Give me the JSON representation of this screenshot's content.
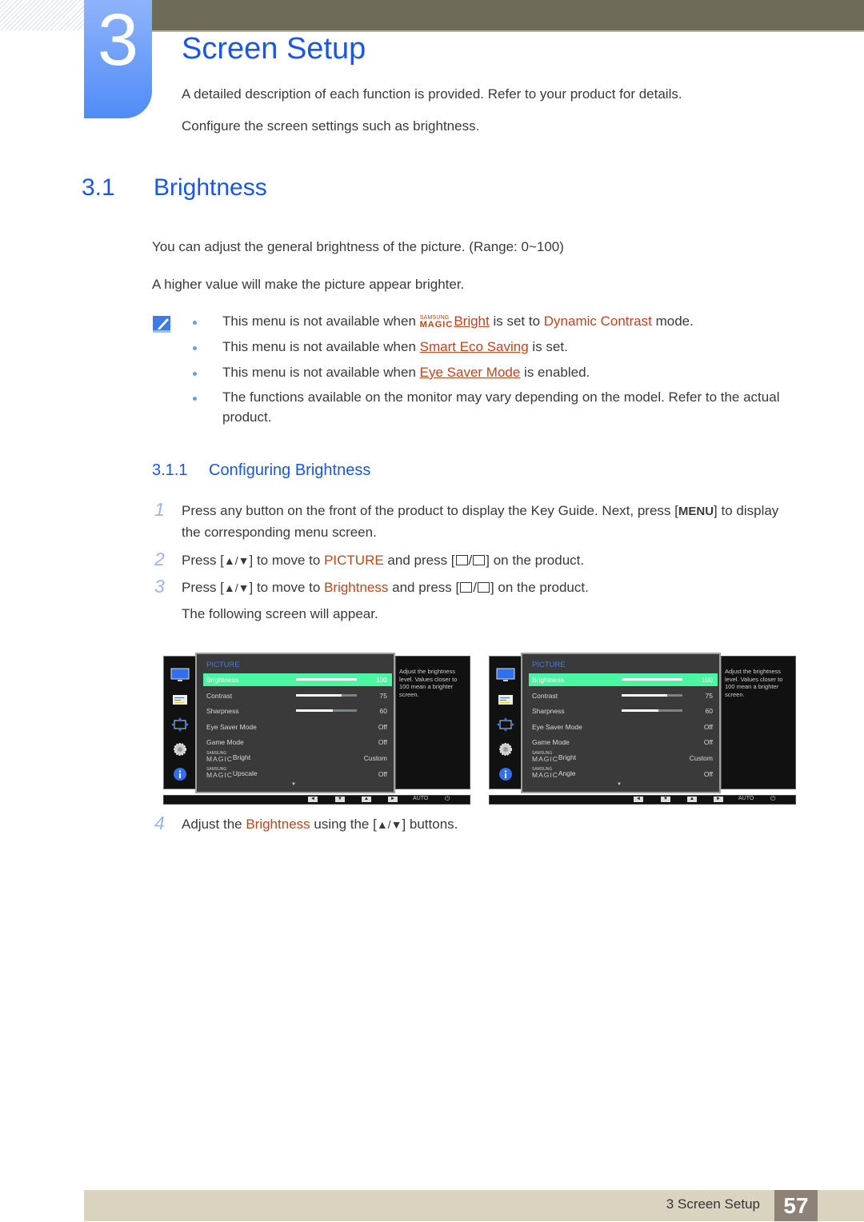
{
  "chapter": {
    "number": "3",
    "title": "Screen Setup",
    "intro": [
      "A detailed description of each function is provided. Refer to your product for details.",
      "Configure the screen settings such as brightness."
    ]
  },
  "section": {
    "number": "3.1",
    "title": "Brightness",
    "paragraphs": [
      "You can adjust the general brightness of the picture. (Range: 0~100)",
      "A higher value will make the picture appear brighter."
    ]
  },
  "notes": {
    "icon": "note-pencil-icon",
    "items": [
      {
        "pre": "This menu is not available when ",
        "magic_top": "SAMSUNG",
        "magic_bottom": "MAGIC",
        "link": "Bright",
        "mid": " is set to ",
        "em": "Dynamic Contrast",
        "post": " mode."
      },
      {
        "pre": "This menu is not available when ",
        "link": "Smart Eco Saving",
        "post": " is set."
      },
      {
        "pre": "This menu is not available when ",
        "link": "Eye Saver Mode",
        "post": " is enabled."
      },
      {
        "line1": "The functions available on the monitor may vary depending on the model. Refer to the actual",
        "line2": "product."
      }
    ]
  },
  "subsection": {
    "number": "3.1.1",
    "title": "Configuring Brightness"
  },
  "steps": [
    {
      "n": "1",
      "line1_pre": "Press any button on the front of the product to display the Key Guide. Next, press [",
      "key": "MENU",
      "line1_post": "] to display",
      "line2": "the corresponding menu screen."
    },
    {
      "n": "2",
      "pre": "Press [",
      "arrows": "▲/▼",
      "mid1": "] to move to ",
      "em": "PICTURE",
      "mid2": " and press [",
      "post": "] on the product."
    },
    {
      "n": "3",
      "pre": "Press [",
      "arrows": "▲/▼",
      "mid1": "] to move to ",
      "em": "Brightness",
      "mid2": " and press [",
      "post": "] on the product.",
      "after": "The following screen will appear."
    },
    {
      "n": "4",
      "pre": "Adjust the ",
      "em": "Brightness",
      "mid": " using the [",
      "arrows": "▲/▼",
      "post": "] buttons."
    }
  ],
  "osd_screens": [
    {
      "menu_title": "PICTURE",
      "description": "Adjust the brightness level. Values closer to 100 mean a brighter screen.",
      "rows": [
        {
          "label": "Brightness",
          "value": "100",
          "level": 1.0,
          "selected": true
        },
        {
          "label": "Contrast",
          "value": "75",
          "level": 0.75
        },
        {
          "label": "Sharpness",
          "value": "60",
          "level": 0.6
        },
        {
          "label": "Eye Saver Mode",
          "value": "Off"
        },
        {
          "label": "Game Mode",
          "value": "Off"
        },
        {
          "magic": true,
          "label": "Bright",
          "value": "Custom"
        },
        {
          "magic": true,
          "label": "Upscale",
          "value": "Off"
        }
      ],
      "side_icons": [
        "monitor-icon",
        "osd-list-icon",
        "resize-arrows-icon",
        "gear-icon",
        "info-icon"
      ],
      "keys": [
        "◄",
        "▼",
        "▲",
        "►"
      ],
      "auto_label": "AUTO",
      "power": "⏻"
    },
    {
      "menu_title": "PICTURE",
      "description": "Adjust the brightness level. Values closer to 100 mean a brighter screen.",
      "rows": [
        {
          "label": "Brightness",
          "value": "100",
          "level": 1.0,
          "selected": true
        },
        {
          "label": "Contrast",
          "value": "75",
          "level": 0.75
        },
        {
          "label": "Sharpness",
          "value": "60",
          "level": 0.6
        },
        {
          "label": "Eye Saver Mode",
          "value": "Off"
        },
        {
          "label": "Game Mode",
          "value": "Off"
        },
        {
          "magic": true,
          "label": "Bright",
          "value": "Custom"
        },
        {
          "magic": true,
          "label": "Angle",
          "value": "Off"
        }
      ],
      "side_icons": [
        "monitor-icon",
        "osd-list-icon",
        "resize-arrows-icon",
        "gear-icon",
        "info-icon"
      ],
      "keys": [
        "◄",
        "▼",
        "▲",
        "►"
      ],
      "auto_label": "AUTO",
      "power": "⏻"
    }
  ],
  "magic_brand": {
    "top": "SAMSUNG",
    "bottom": "MAGIC"
  },
  "footer": {
    "section_label": "3 Screen Setup",
    "page_number": "57"
  },
  "colors": {
    "heading_blue": "#1a55ee",
    "accent_orange": "#c0441a",
    "osd_highlight": "#4bf5a2",
    "top_bar": "#6e6b58",
    "footer_bg": "#d9d3c0",
    "page_badge": "#8e8276"
  }
}
